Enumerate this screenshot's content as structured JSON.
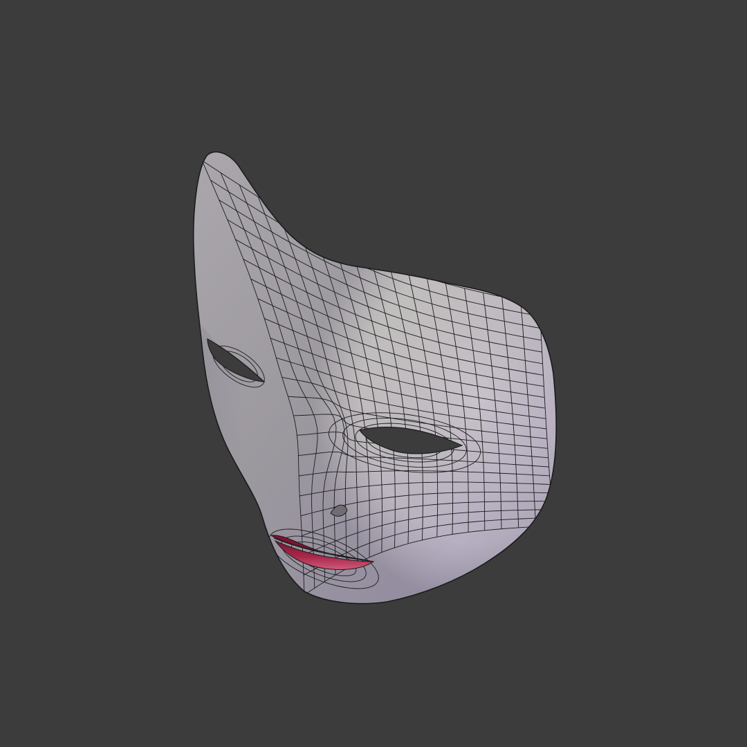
{
  "scene": {
    "background_color": "#3c3c3c",
    "object": "half-face-mask",
    "display_mode": "wireframe-overlay",
    "colors": {
      "mask_light": "#e6e3de",
      "mask_mid": "#cfccc8",
      "mask_shadow": "#aaa8b5",
      "mask_edge_tint": "#c4bccd",
      "wire": "#1b1b1b",
      "eye_hole": "#3c3c3c",
      "lip_upper": "#7c1430",
      "lip_lower": "#a8284a",
      "lip_highlight": "#d05a7c",
      "nostril": "#6f6d73"
    }
  }
}
